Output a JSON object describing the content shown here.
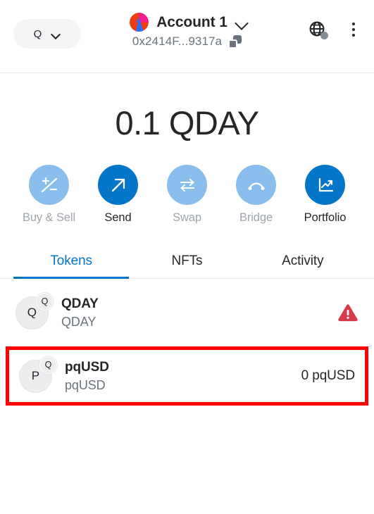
{
  "header": {
    "network_pill_label": "Q",
    "account_name": "Account 1",
    "account_address": "0x2414F...9317a",
    "network_icon_name": "globe-icon",
    "menu_icon_name": "kebab-menu-icon",
    "copy_icon_name": "copy-icon"
  },
  "balance": {
    "amount": "0.1",
    "symbol": "QDAY",
    "display": "0.1 QDAY"
  },
  "actions": [
    {
      "label": "Buy & Sell",
      "icon": "buy-sell-icon",
      "enabled": false
    },
    {
      "label": "Send",
      "icon": "send-arrow-icon",
      "enabled": true
    },
    {
      "label": "Swap",
      "icon": "swap-arrows-icon",
      "enabled": false
    },
    {
      "label": "Bridge",
      "icon": "bridge-arc-icon",
      "enabled": false
    },
    {
      "label": "Portfolio",
      "icon": "portfolio-chart-icon",
      "enabled": true
    }
  ],
  "tabs": [
    {
      "label": "Tokens",
      "active": true
    },
    {
      "label": "NFTs",
      "active": false
    },
    {
      "label": "Activity",
      "active": false
    }
  ],
  "tokens": [
    {
      "symbol": "QDAY",
      "name": "QDAY",
      "icon_letter": "Q",
      "badge_letter": "Q",
      "amount": "",
      "status_icon": "warning-triangle-icon",
      "highlighted": false
    },
    {
      "symbol": "pqUSD",
      "name": "pqUSD",
      "icon_letter": "P",
      "badge_letter": "Q",
      "amount": "0 pqUSD",
      "status_icon": "",
      "highlighted": true
    }
  ],
  "colors": {
    "accent": "#0376c9",
    "accent_muted": "#89bdeb",
    "highlight_border": "#fe0000",
    "warning": "#d73a49",
    "text_primary": "#24272a",
    "text_muted": "#6a737d"
  }
}
